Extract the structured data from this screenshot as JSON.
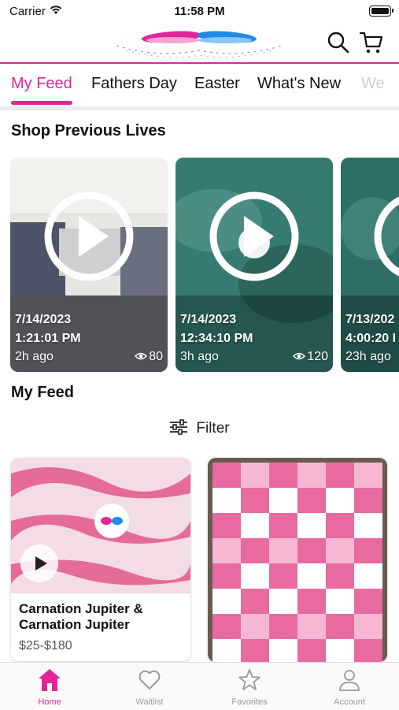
{
  "status_bar": {
    "carrier": "Carrier",
    "time": "11:58 PM"
  },
  "header": {
    "logo_icon": "brand-logo",
    "search_icon": "search-icon",
    "cart_icon": "cart-icon"
  },
  "tabs": [
    {
      "label": "My Feed",
      "active": true
    },
    {
      "label": "Fathers Day"
    },
    {
      "label": "Easter"
    },
    {
      "label": "What's New"
    },
    {
      "label": "We"
    }
  ],
  "shop_previous_lives": {
    "title": "Shop Previous Lives",
    "cards": [
      {
        "date": "7/14/2023",
        "time": "1:21:01 PM",
        "ago": "2h ago",
        "views": "80"
      },
      {
        "date": "7/14/2023",
        "time": "12:34:10 PM",
        "ago": "3h ago",
        "views": "120"
      },
      {
        "date": "7/13/202",
        "time": "4:00:20 I",
        "ago": "23h ago",
        "views": ""
      }
    ]
  },
  "my_feed": {
    "title": "My Feed",
    "filter_label": "Filter",
    "items": [
      {
        "name": "Carnation Jupiter & Carnation Jupiter",
        "price": "$25-$180"
      },
      {
        "name": "",
        "price": ""
      }
    ]
  },
  "tab_bar": [
    {
      "label": "Home",
      "icon": "home-icon",
      "active": true
    },
    {
      "label": "Waitlist",
      "icon": "heart-icon"
    },
    {
      "label": "Favorites",
      "icon": "star-icon"
    },
    {
      "label": "Account",
      "icon": "account-icon"
    }
  ],
  "colors": {
    "accent": "#e2259a",
    "inactive": "#9a9a9a"
  }
}
